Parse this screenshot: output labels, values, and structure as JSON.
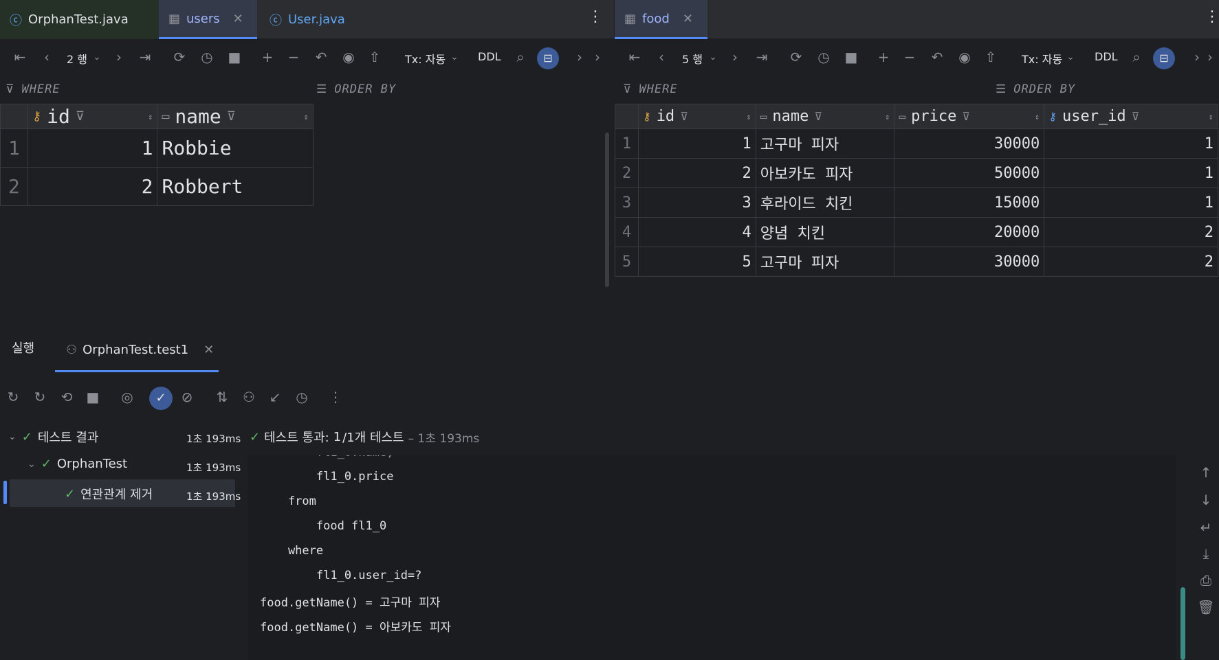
{
  "left_tabs": [
    {
      "label": "OrphanTest.java",
      "icon": "java-class-icon"
    },
    {
      "label": "users",
      "icon": "table-icon",
      "active": true
    },
    {
      "label": "User.java",
      "icon": "class-c-icon"
    }
  ],
  "right_tabs": [
    {
      "label": "food",
      "icon": "table-icon",
      "active": true
    }
  ],
  "users_toolbar": {
    "rows": "2 행",
    "tx": "Tx: 자동",
    "ddl": "DDL"
  },
  "food_toolbar": {
    "rows": "5 행",
    "tx": "Tx: 자동",
    "ddl": "DDL"
  },
  "filters": {
    "where": "WHERE",
    "order_by": "ORDER BY"
  },
  "users_table": {
    "columns": [
      "id",
      "name"
    ],
    "rows": [
      {
        "n": "1",
        "id": "1",
        "name": "Robbie"
      },
      {
        "n": "2",
        "id": "2",
        "name": "Robbert"
      }
    ]
  },
  "food_table": {
    "columns": [
      "id",
      "name",
      "price",
      "user_id"
    ],
    "rows": [
      {
        "n": "1",
        "id": "1",
        "name": "고구마 피자",
        "price": "30000",
        "user_id": "1"
      },
      {
        "n": "2",
        "id": "2",
        "name": "아보카도 피자",
        "price": "50000",
        "user_id": "1"
      },
      {
        "n": "3",
        "id": "3",
        "name": "후라이드 치킨",
        "price": "15000",
        "user_id": "1"
      },
      {
        "n": "4",
        "id": "4",
        "name": "양념 치킨",
        "price": "20000",
        "user_id": "2"
      },
      {
        "n": "5",
        "id": "5",
        "name": "고구마 피자",
        "price": "30000",
        "user_id": "2"
      }
    ]
  },
  "run_panel": {
    "tab_run": "실행",
    "tab_config": "OrphanTest.test1",
    "tree": [
      {
        "label": "테스트 결과",
        "time": "1초 193ms"
      },
      {
        "label": "OrphanTest",
        "time": "1초 193ms"
      },
      {
        "label": "연관관계 제거",
        "time": "1초 193ms"
      }
    ],
    "status": {
      "prefix": "테스트 통과:",
      "count": "1",
      "suffix": "/1개 테스트",
      "duration": "– 1초 193ms"
    },
    "console": [
      "        fl1_0.price",
      "    from",
      "        food fl1_0",
      "    where",
      "        fl1_0.user_id=?",
      "food.getName() = 고구마 피자",
      "food.getName() = 아보카도 피자"
    ]
  }
}
